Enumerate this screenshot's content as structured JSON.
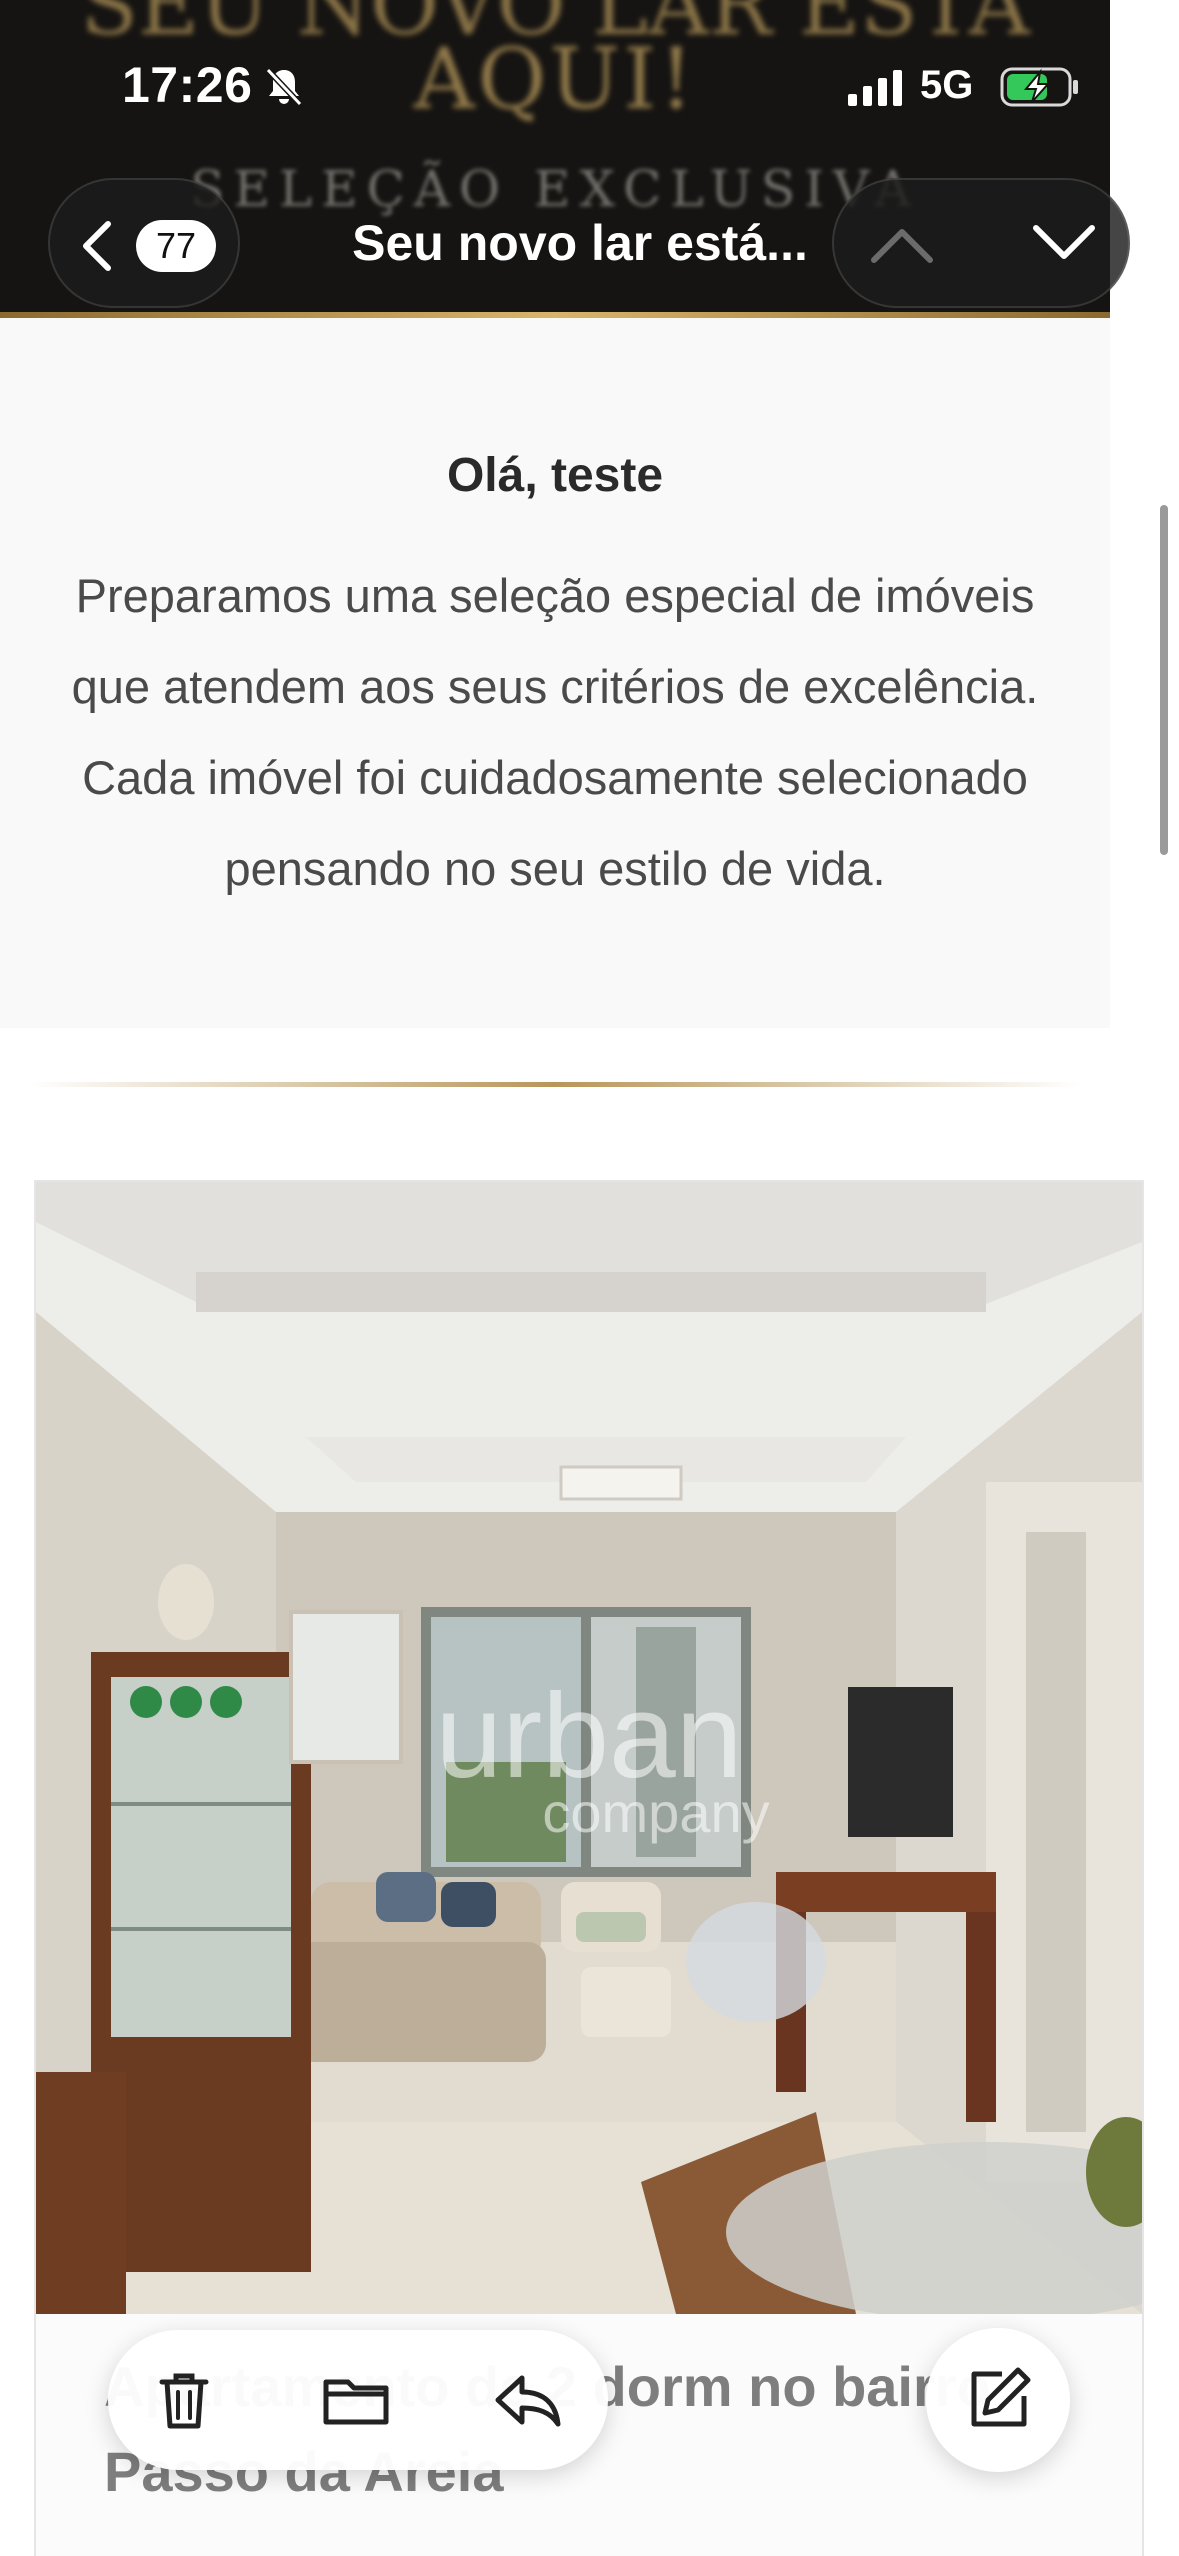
{
  "status_bar": {
    "time": "17:26",
    "network": "5G",
    "icons": [
      "bell-slash-icon",
      "signal-bars-icon",
      "battery-charging-icon"
    ]
  },
  "nav": {
    "back_count": "77",
    "title": "Seu novo lar está...",
    "icons": [
      "chevron-left-icon",
      "chevron-up-icon",
      "chevron-down-icon"
    ]
  },
  "email_header": {
    "headline_partial": "SEU NOVO LAR ESTÁ",
    "headline": "AQUI!",
    "subheadline": "SELEÇÃO EXCLUSIVA"
  },
  "email_body": {
    "greeting": "Olá, teste",
    "intro": "Preparamos uma seleção especial de imóveis que atendem aos seus critérios de excelência. Cada imóvel foi cuidadosamente selecionado pensando no seu estilo de vida."
  },
  "property": {
    "photo_watermark": "urban",
    "photo_watermark_sub": "company",
    "title": "Apartamento de 2 dorm no bairro Passo da Areia"
  },
  "toolbar": {
    "icons": [
      "trash-icon",
      "folder-icon",
      "reply-icon",
      "compose-icon"
    ]
  },
  "colors": {
    "header_bg": "#161412",
    "gold": "#b8965a",
    "body_bg": "#f9f9f9",
    "text": "#4a4a4a"
  }
}
